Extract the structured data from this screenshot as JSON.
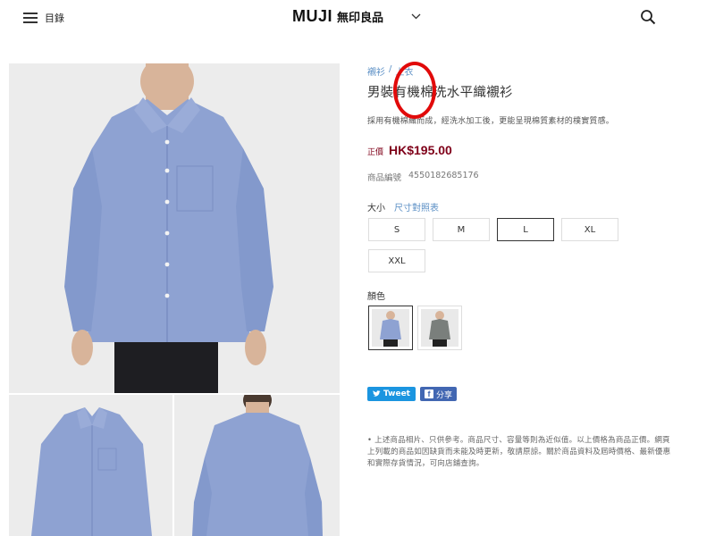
{
  "header": {
    "menu_label": "目錄",
    "logo_en": "MUJI",
    "logo_zh": "無印良品",
    "icons": {
      "menu": "hamburger-icon",
      "language": "chevron-down-icon",
      "search": "search-icon"
    }
  },
  "breadcrumb": [
    "襯衫",
    "上衣"
  ],
  "product": {
    "title": "男裝有機棉洗水平織襯衫",
    "description": "採用有機棉織而成，經洗水加工後，更能呈現棉質素材的樸實質感。",
    "price_label": "正價",
    "price": "HK$195.00",
    "sku_label": "商品編號",
    "sku": "4550182685176"
  },
  "size": {
    "label": "大小",
    "chart_link": "尺寸對照表",
    "options": [
      "S",
      "M",
      "L",
      "XL",
      "XXL"
    ],
    "selected": "L"
  },
  "color": {
    "label": "顏色",
    "options": [
      "blue",
      "gray"
    ],
    "selected": "blue"
  },
  "share": {
    "tweet_label": "Tweet",
    "fb_label": "分享"
  },
  "disclaimer": "• 上述商品相片、只供參考。商品尺寸、容量等則為近似值。以上價格為商品正價。網頁上列載的商品如因缺貨而未能及時更新，敬請原諒。關於商品資料及屆時價格、最新優惠和實際存貨情況，可向店鋪查詢。",
  "colors": {
    "price": "#7f0019",
    "link": "#5b8fc5",
    "annotation": "#e10a0a",
    "shirt_blue": "#8ea2d2"
  }
}
